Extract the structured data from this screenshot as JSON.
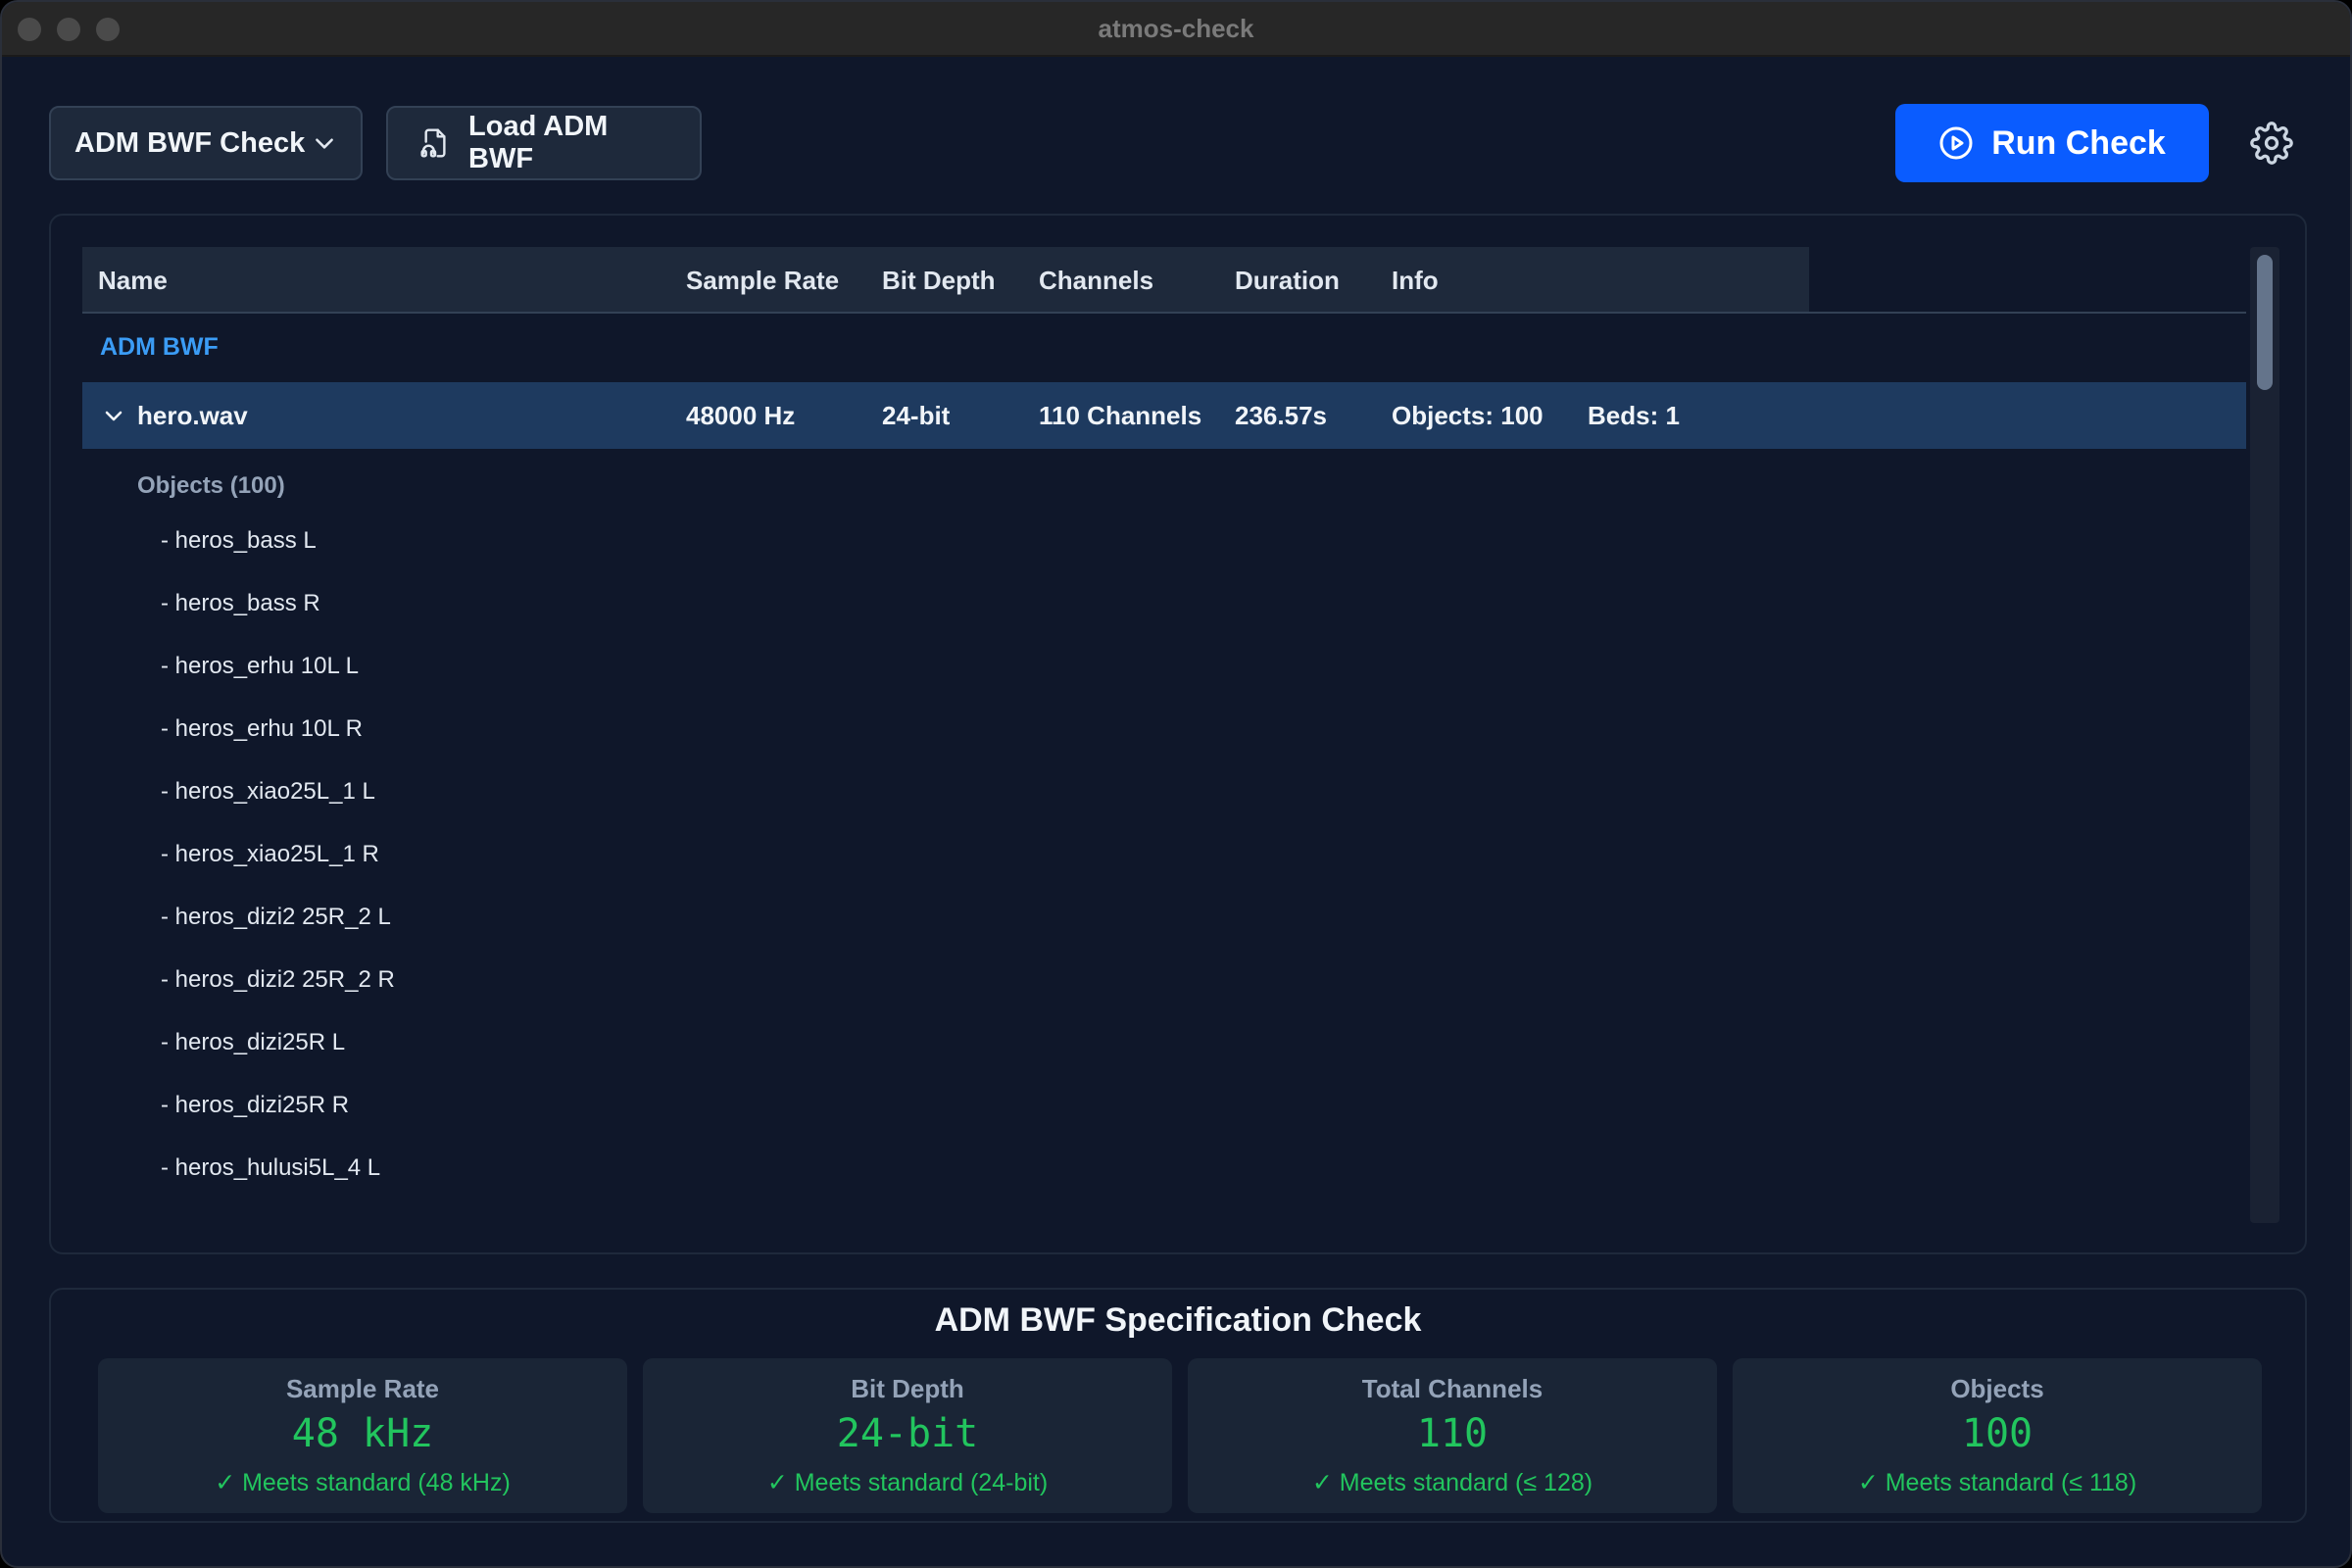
{
  "window": {
    "title": "atmos-check"
  },
  "toolbar": {
    "mode_label": "ADM BWF Check",
    "load_label": "Load ADM BWF",
    "run_label": "Run Check"
  },
  "table": {
    "columns": [
      "Name",
      "Sample Rate",
      "Bit Depth",
      "Channels",
      "Duration",
      "Info"
    ],
    "group": "ADM BWF",
    "file": {
      "name": "hero.wav",
      "sample_rate": "48000 Hz",
      "bit_depth": "24-bit",
      "channels": "110 Channels",
      "duration": "236.57s",
      "objects": "Objects: 100",
      "beds": "Beds: 1"
    },
    "objects_heading": "Objects (100)",
    "objects": [
      "- heros_bass L",
      "- heros_bass R",
      "- heros_erhu 10L L",
      "- heros_erhu 10L R",
      "- heros_xiao25L_1 L",
      "- heros_xiao25L_1 R",
      "- heros_dizi2 25R_2 L",
      "- heros_dizi2 25R_2 R",
      "- heros_dizi25R L",
      "- heros_dizi25R R",
      "- heros_hulusi5L_4 L"
    ]
  },
  "spec": {
    "title": "ADM BWF Specification Check",
    "cards": [
      {
        "label": "Sample Rate",
        "value": "48 kHz",
        "status": "✓ Meets standard (48 kHz)"
      },
      {
        "label": "Bit Depth",
        "value": "24-bit",
        "status": "✓ Meets standard (24-bit)"
      },
      {
        "label": "Total Channels",
        "value": "110",
        "status": "✓ Meets standard (≤ 128)"
      },
      {
        "label": "Objects",
        "value": "100",
        "status": "✓ Meets standard (≤ 118)"
      }
    ]
  },
  "colors": {
    "accent": "#0a5cff",
    "success": "#22c55e",
    "selected_row": "#1e3a5f",
    "link": "#3b9cf5"
  },
  "icons": [
    "chevron-down-icon",
    "file-audio-icon",
    "play-circle-icon",
    "gear-icon",
    "row-chevron-icon"
  ]
}
